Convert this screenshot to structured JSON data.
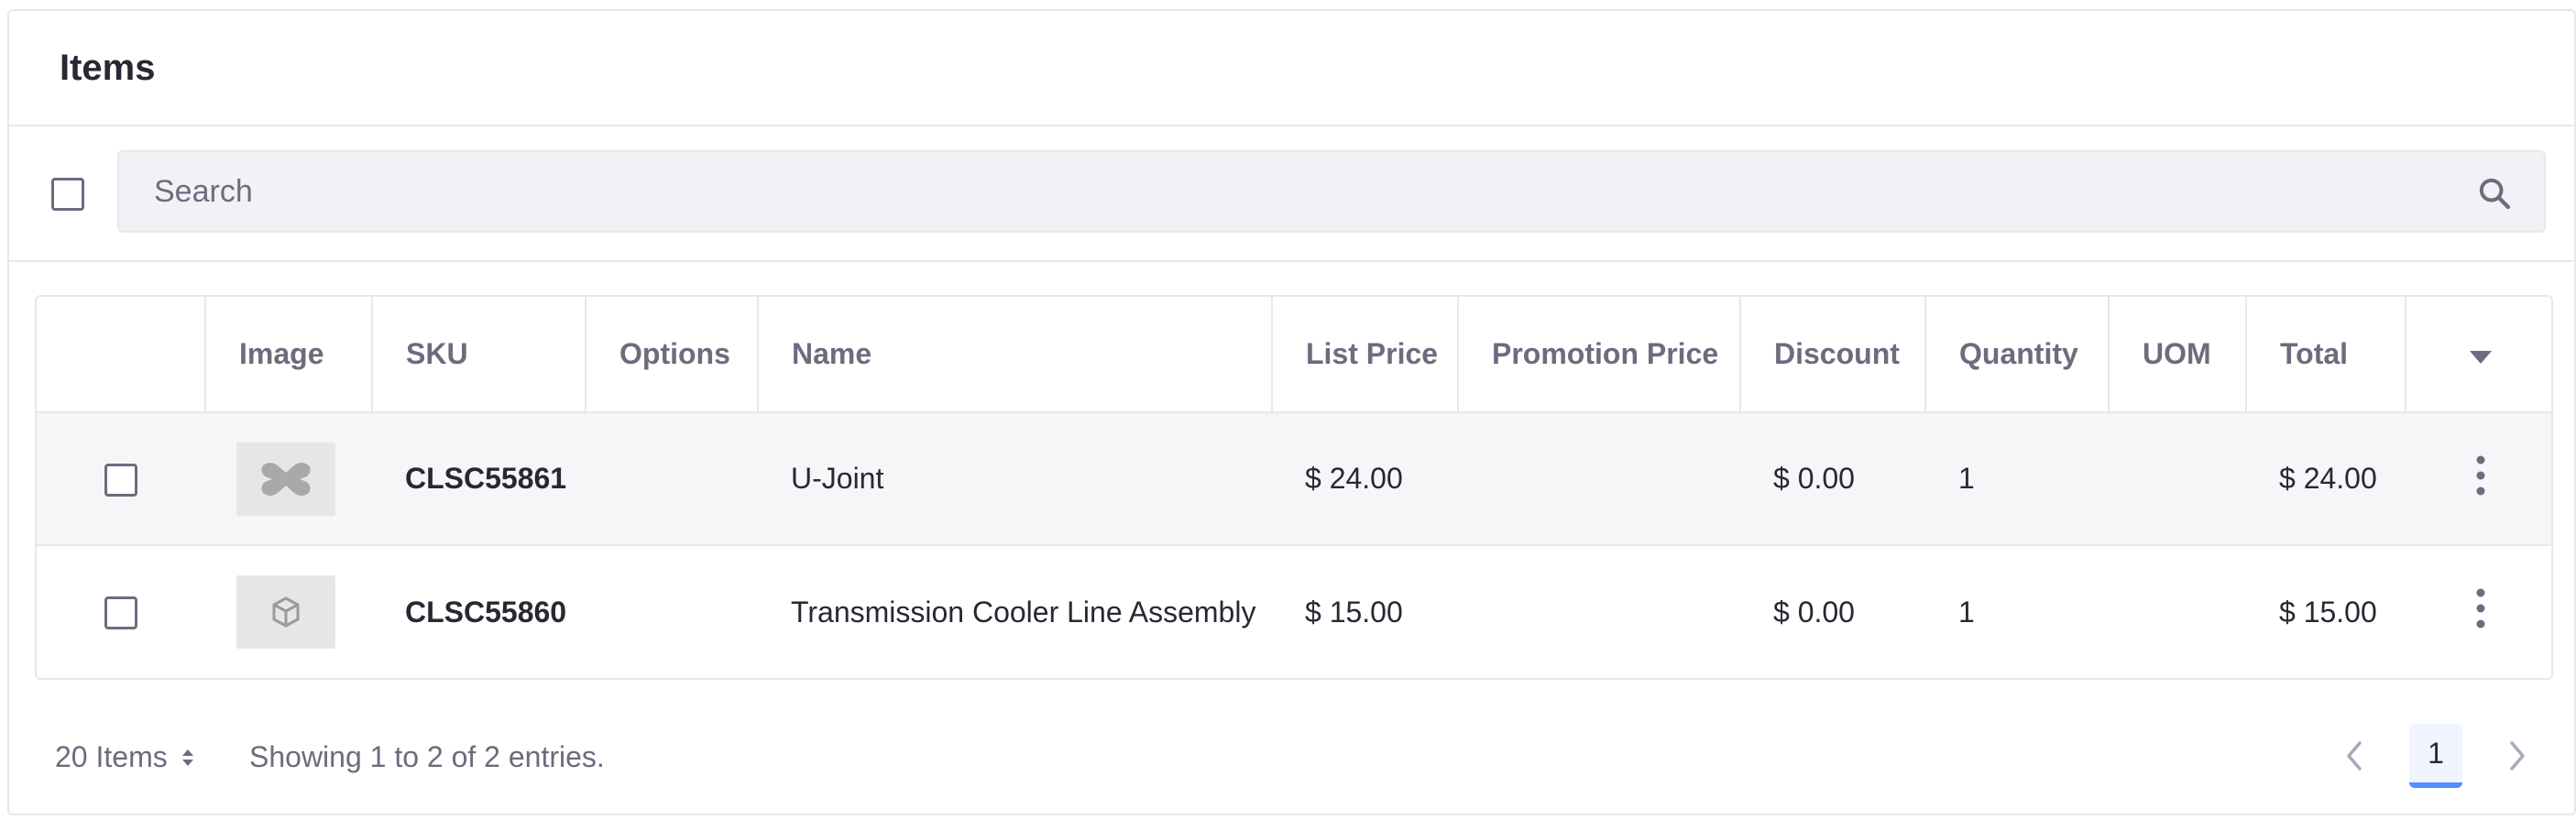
{
  "card": {
    "title": "Items"
  },
  "search": {
    "placeholder": "Search"
  },
  "table": {
    "columns": [
      "Image",
      "SKU",
      "Options",
      "Name",
      "List Price",
      "Promotion Price",
      "Discount",
      "Quantity",
      "UOM",
      "Total"
    ],
    "rows": [
      {
        "sku": "CLSC55861",
        "options": "",
        "name": "U-Joint",
        "list_price": "$ 24.00",
        "promotion_price": "",
        "discount": "$ 0.00",
        "quantity": "1",
        "uom": "",
        "total": "$ 24.00",
        "image_icon": "u-joint-thumbnail"
      },
      {
        "sku": "CLSC55860",
        "options": "",
        "name": "Transmission Cooler Line Assembly",
        "list_price": "$ 15.00",
        "promotion_price": "",
        "discount": "$ 0.00",
        "quantity": "1",
        "uom": "",
        "total": "$ 15.00",
        "image_icon": "placeholder-box-icon"
      }
    ]
  },
  "footer": {
    "page_size": "20 Items",
    "showing": "Showing 1 to 2 of 2 entries.",
    "current_page": "1"
  },
  "colors": {
    "accent": "#528eff",
    "border": "#e7e7ed",
    "muted_text": "#6b6c7e"
  }
}
